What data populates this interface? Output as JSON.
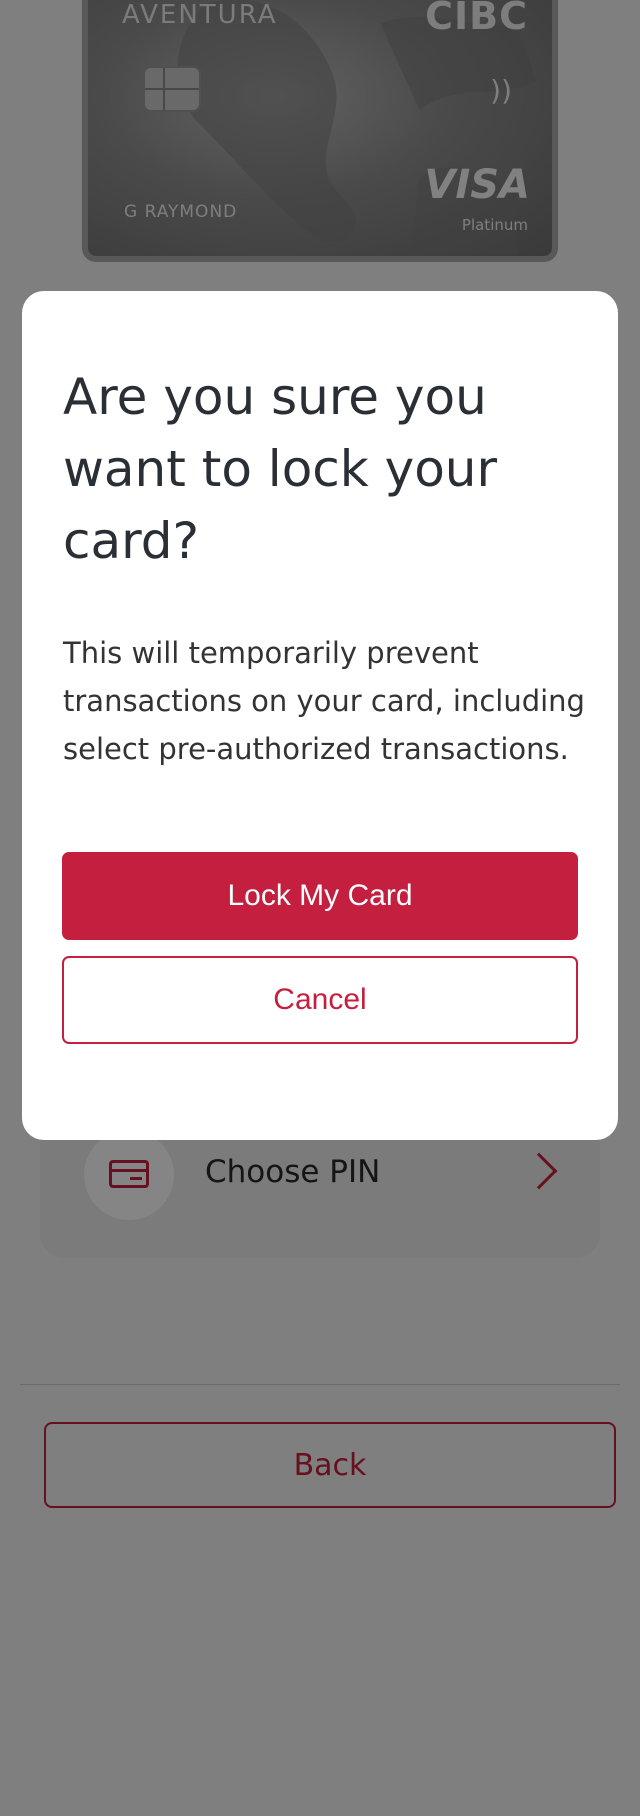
{
  "card": {
    "brand": "AVENTURA",
    "bank": "CIBC",
    "holder": "G RAYMOND",
    "network": "VISA",
    "tier": "Platinum",
    "contactless_symbol": "))"
  },
  "options": {
    "items": [
      {
        "label": "Choose PIN",
        "icon": "card-icon"
      }
    ]
  },
  "footer": {
    "back_label": "Back"
  },
  "dialog": {
    "title": "Are you sure you want to lock your card?",
    "body": "This will temporarily prevent transactions on your card, including select pre-authorized transactions.",
    "confirm_label": "Lock My Card",
    "cancel_label": "Cancel"
  },
  "colors": {
    "accent": "#c41f3e",
    "overlay": "rgba(0,0,0,0.48)",
    "dialog_bg": "#ffffff"
  }
}
